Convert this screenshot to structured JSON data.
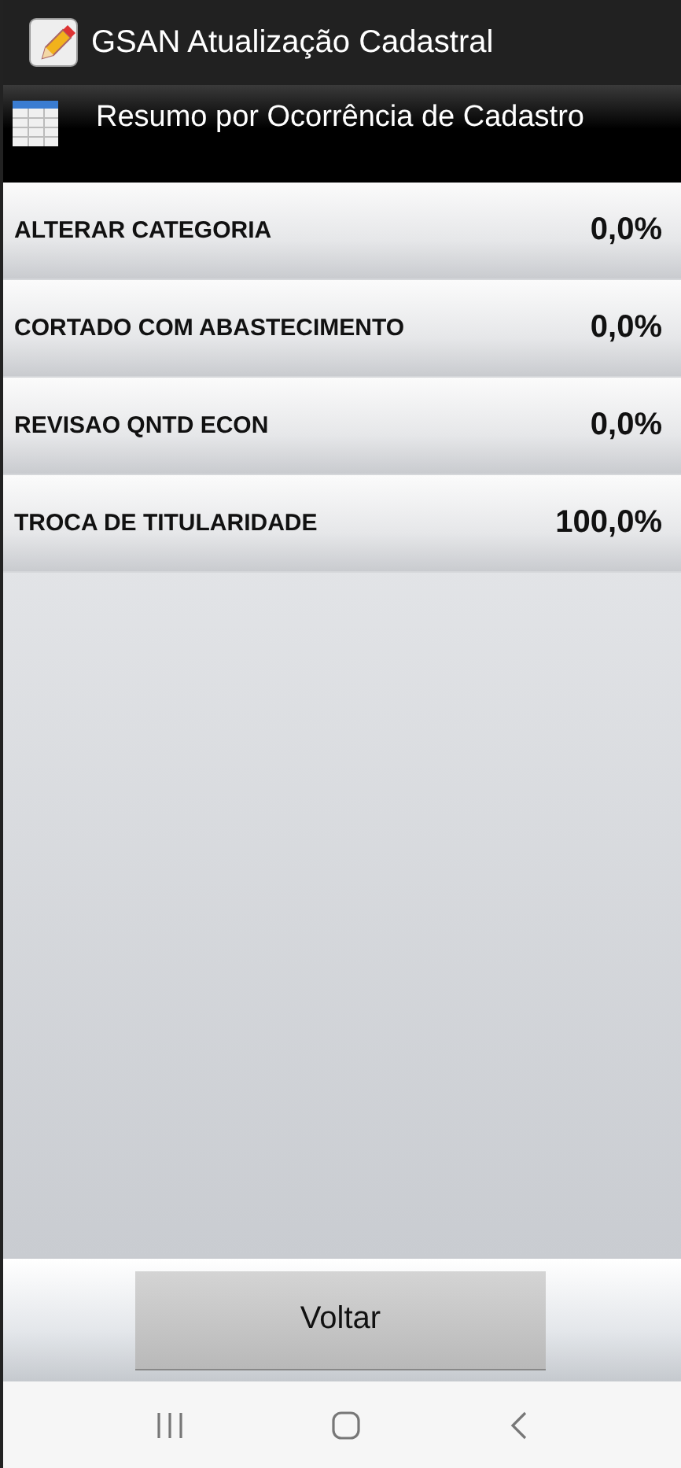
{
  "app_bar": {
    "title": "GSAN Atualização Cadastral"
  },
  "header": {
    "title": "Resumo por Ocorrência de Cadastro"
  },
  "rows": [
    {
      "label": "ALTERAR CATEGORIA",
      "value": "0,0%"
    },
    {
      "label": "CORTADO COM ABASTECIMENTO",
      "value": "0,0%"
    },
    {
      "label": "REVISAO QNTD ECON",
      "value": "0,0%"
    },
    {
      "label": "TROCA DE TITULARIDADE",
      "value": "100,0%"
    }
  ],
  "buttons": [
    "Voltar"
  ]
}
